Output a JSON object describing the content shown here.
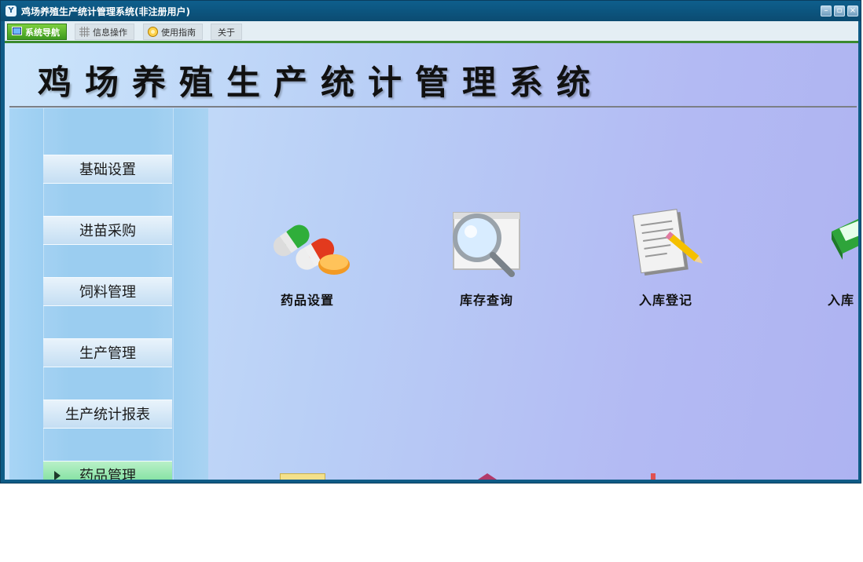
{
  "window": {
    "title": "鸡场养殖生产统计管理系统(非注册用户)",
    "app_icon": "Y"
  },
  "menubar": {
    "tabs": [
      {
        "label": "系统导航",
        "icon": "monitor-icon",
        "active": true
      },
      {
        "label": "信息操作",
        "icon": "grid-icon",
        "active": false
      },
      {
        "label": "使用指南",
        "icon": "help-icon",
        "active": false
      },
      {
        "label": "关于",
        "icon": "",
        "active": false
      }
    ]
  },
  "banner": {
    "title": "鸡场养殖生产统计管理系统"
  },
  "sidebar": {
    "items": [
      {
        "label": "基础设置",
        "active": false
      },
      {
        "label": "进苗采购",
        "active": false
      },
      {
        "label": "饲料管理",
        "active": false
      },
      {
        "label": "生产管理",
        "active": false
      },
      {
        "label": "生产统计报表",
        "active": false
      },
      {
        "label": "药品管理",
        "active": true
      }
    ]
  },
  "functions": [
    {
      "label": "药品设置",
      "icon": "pills-icon"
    },
    {
      "label": "库存查询",
      "icon": "magnifier-icon"
    },
    {
      "label": "入库登记",
      "icon": "notepad-pencil-icon"
    },
    {
      "label": "入库",
      "icon": "books-icon"
    }
  ],
  "colors": {
    "title_bar": "#0b4b71",
    "active_tab": "#3d9a1f",
    "active_sidebar": "#6fdc93",
    "content_left": "#cbe5fb",
    "content_right": "#aeb3f2"
  }
}
